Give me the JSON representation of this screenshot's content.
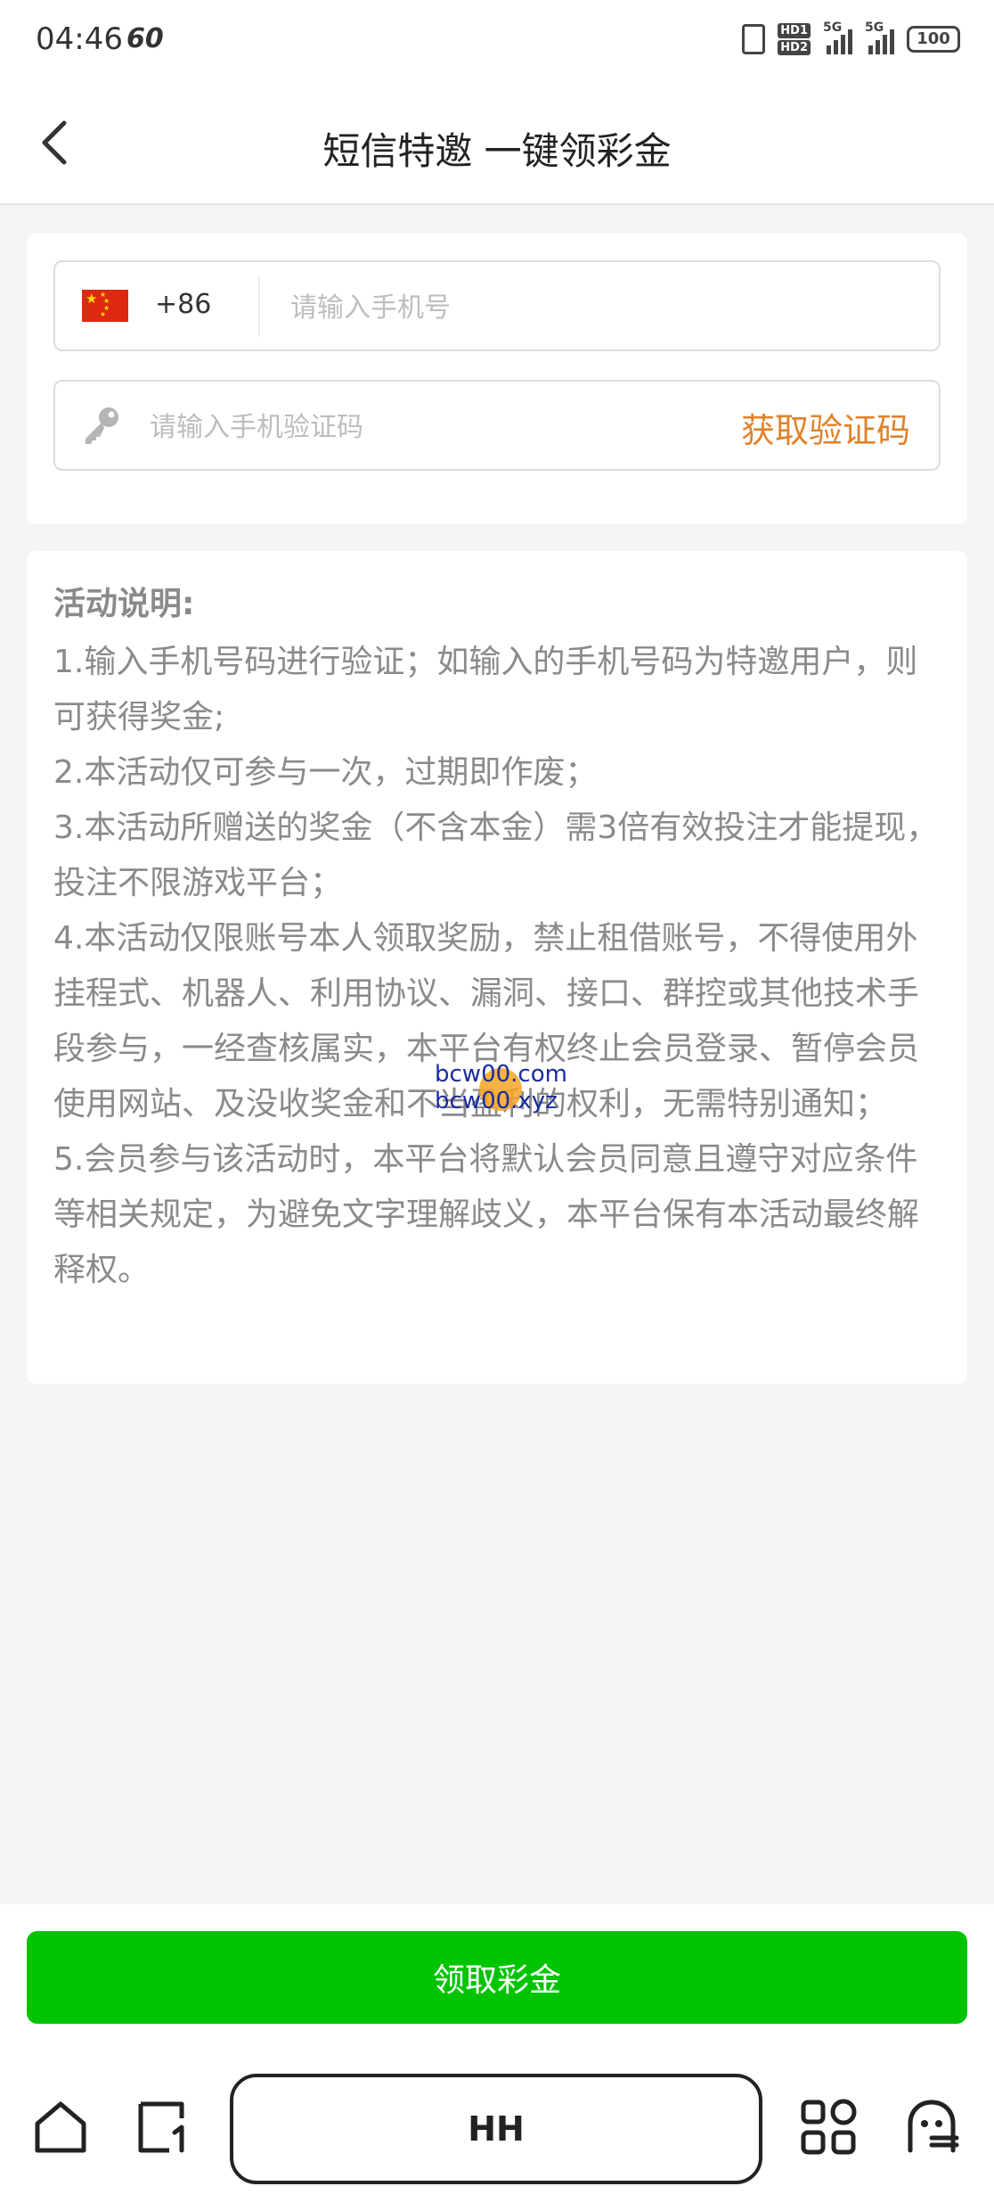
{
  "status_bar": {
    "time": "04:46",
    "refresh_rate": "60",
    "hd1": "HD1",
    "hd2": "HD2",
    "net1": "5G",
    "net2": "5G",
    "battery": "100"
  },
  "header": {
    "title": "短信特邀 一键领彩金"
  },
  "form": {
    "country_code": "+86",
    "phone_placeholder": "请输入手机号",
    "code_placeholder": "请输入手机验证码",
    "get_code_label": "获取验证码"
  },
  "rules": {
    "title": "活动说明:",
    "items": [
      "1.输入手机号码进行验证；如输入的手机号码为特邀用户，则可获得奖金;",
      "2.本活动仅可参与一次，过期即作废；",
      "3.本活动所赠送的奖金（不含本金）需3倍有效投注才能提现，投注不限游戏平台；",
      "4.本活动仅限账号本人领取奖励，禁止租借账号，不得使用外挂程式、机器人、利用协议、漏洞、接口、群控或其他技术手段参与，一经查核属实，本平台有权终止会员登录、暂停会员使用网站、及没收奖金和不当盈利的权利，无需特别通知；",
      "5.会员参与该活动时，本平台将默认会员同意且遵守对应条件等相关规定，为避免文字理解歧义，本平台保有本活动最终解释权。"
    ]
  },
  "watermark": {
    "line1": "bcw00.com",
    "line2": "bcw00.xyz"
  },
  "footer": {
    "claim_label": "领取彩金"
  },
  "browser_bar": {
    "address_text": "HH",
    "icons": [
      "home-icon",
      "tabs-icon",
      "apps-grid-icon",
      "ghost-icon"
    ]
  },
  "colors": {
    "accent_green": "#00c402",
    "accent_orange": "#e0822a",
    "flag_red": "#de2910"
  }
}
